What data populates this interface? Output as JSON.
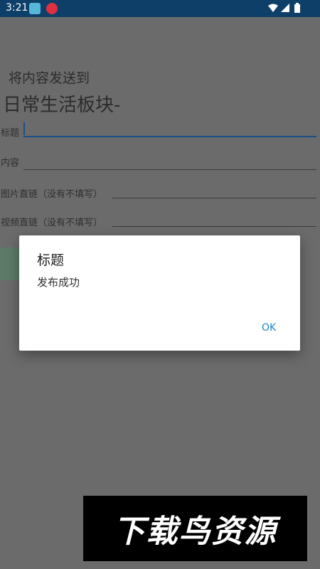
{
  "status_bar": {
    "time": "3:21",
    "icons": [
      "app-icon-1",
      "app-icon-2",
      "wifi-icon",
      "signal-icon",
      "battery-icon"
    ]
  },
  "form": {
    "send_to_label": "将内容发送到",
    "board_name": "日常生活板块-",
    "fields": [
      {
        "label": "标题",
        "value": ""
      },
      {
        "label": "内容",
        "value": ""
      },
      {
        "label": "图片直链（没有不填写）",
        "value": ""
      },
      {
        "label": "视频直链（没有不填写）",
        "value": ""
      }
    ]
  },
  "dialog": {
    "title": "标题",
    "message": "发布成功",
    "ok_label": "OK"
  },
  "watermark": {
    "text": "下载鸟资源"
  },
  "colors": {
    "status_bar": "#0e3f68",
    "background_dimmed": "#6b6b6b",
    "accent": "#1b84c9"
  }
}
